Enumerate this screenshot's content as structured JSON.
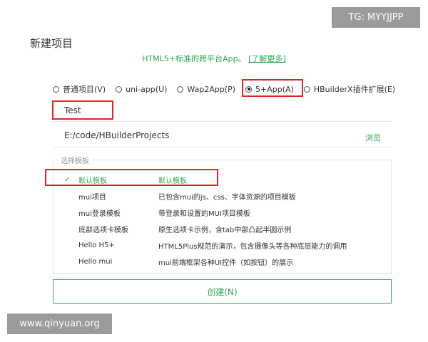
{
  "dialog": {
    "title": "新建项目",
    "subtitle": "HTML5+标准的跨平台App。",
    "learn_more": "[了解更多]"
  },
  "project_types": [
    {
      "label": "普通项目(V)",
      "selected": false
    },
    {
      "label": "uni-app(U)",
      "selected": false
    },
    {
      "label": "Wap2App(P)",
      "selected": false
    },
    {
      "label": "5+App(A)",
      "selected": true
    },
    {
      "label": "HBuilderX插件扩展(E)",
      "selected": false
    }
  ],
  "project_name": "Test",
  "location": {
    "path": "E:/code/HBuilderProjects",
    "browse_label": "浏览"
  },
  "template_section": {
    "legend": "选择模板",
    "templates": [
      {
        "name": "默认模板",
        "desc": "默认模板",
        "selected": true
      },
      {
        "name": "mui项目",
        "desc": "已包含mui的js、css、字体资源的项目模板",
        "selected": false
      },
      {
        "name": "mui登录模板",
        "desc": "带登录和设置的MUI项目模板",
        "selected": false
      },
      {
        "name": "底部选项卡模板",
        "desc": "原生选项卡示例，含tab中部凸起半圆示例",
        "selected": false
      },
      {
        "name": "Hello H5+",
        "desc": "HTML5Plus规范的演示，包含摄像头等各种底层能力的调用",
        "selected": false
      },
      {
        "name": "Hello mui",
        "desc": "mui前端框架各种UI控件（如按钮）的展示",
        "selected": false
      }
    ]
  },
  "create_button": "创建(N)",
  "watermarks": {
    "top_right": "TG: MYYJJPP",
    "bottom_left": "www.qinyuan.org"
  },
  "colors": {
    "accent_green": "#2fa84f",
    "highlight_red": "#e0242a"
  }
}
